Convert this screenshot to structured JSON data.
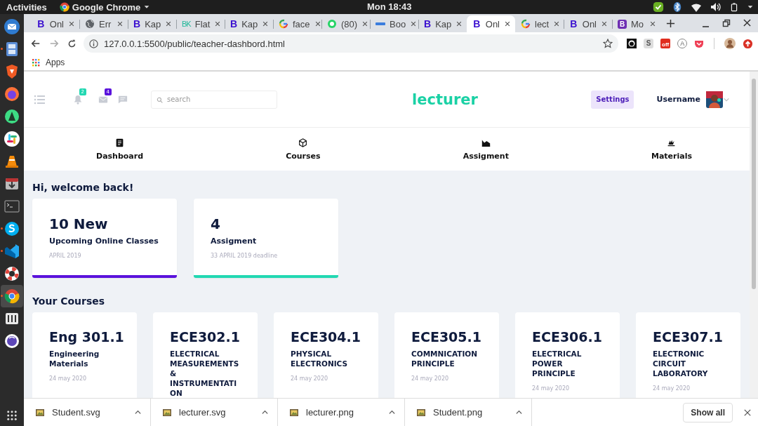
{
  "top_bar": {
    "activities": "Activities",
    "app_name": "Google Chrome",
    "clock": "Mon 18:43"
  },
  "dock": [
    {
      "kind": "mail",
      "running": false,
      "selected": false
    },
    {
      "kind": "files",
      "running": true,
      "selected": false
    },
    {
      "kind": "brave",
      "running": false,
      "selected": false
    },
    {
      "kind": "firefox",
      "running": false,
      "selected": false
    },
    {
      "kind": "android",
      "running": false,
      "selected": false
    },
    {
      "kind": "slack",
      "running": false,
      "selected": false
    },
    {
      "kind": "vlc",
      "running": false,
      "selected": false
    },
    {
      "kind": "transmission",
      "running": false,
      "selected": false
    },
    {
      "kind": "terminal",
      "running": false,
      "selected": false
    },
    {
      "kind": "skype",
      "running": true,
      "selected": false
    },
    {
      "kind": "vscode",
      "running": true,
      "selected": false
    },
    {
      "kind": "help",
      "running": false,
      "selected": false
    },
    {
      "kind": "chrome",
      "running": true,
      "selected": true
    },
    {
      "kind": "mixer",
      "running": false,
      "selected": false
    },
    {
      "kind": "eclipse",
      "running": false,
      "selected": false
    }
  ],
  "browser": {
    "tabs": [
      {
        "kind": "letter",
        "glyph": "B",
        "title": "Onl",
        "selected": false
      },
      {
        "kind": "globe",
        "title": "Err",
        "selected": false
      },
      {
        "kind": "letter",
        "glyph": "B",
        "title": "Kap",
        "selected": false
      },
      {
        "kind": "outline",
        "glyph": "BK",
        "title": "Flat",
        "selected": false
      },
      {
        "kind": "letter",
        "glyph": "B",
        "title": "Kap",
        "selected": false
      },
      {
        "kind": "google",
        "title": "face",
        "selected": false
      },
      {
        "kind": "chat",
        "title": "(80)",
        "selected": false
      },
      {
        "kind": "bar",
        "title": "Boo",
        "selected": false
      },
      {
        "kind": "letter",
        "glyph": "B",
        "title": "Kap",
        "selected": false
      },
      {
        "kind": "letter",
        "glyph": "B",
        "title": "Onl",
        "selected": true
      },
      {
        "kind": "google",
        "title": "lect",
        "selected": false
      },
      {
        "kind": "letter",
        "glyph": "B",
        "title": "Onl",
        "selected": false
      },
      {
        "kind": "square",
        "glyph": "B",
        "title": "Mo",
        "selected": false
      }
    ],
    "url": "127.0.0.1:5500/public/teacher-dashbord.html",
    "extensions": [
      {
        "kind": "github"
      },
      {
        "kind": "letter",
        "glyph": "S"
      },
      {
        "kind": "badge",
        "glyph": "off"
      },
      {
        "kind": "circle-letter",
        "glyph": "A"
      },
      {
        "kind": "pocket"
      }
    ],
    "bookmarks": [
      {
        "label": "Apps"
      }
    ]
  },
  "page": {
    "header": {
      "notifications": "2",
      "messages": "4",
      "search_placeholder": "search",
      "logo": "lecturer",
      "settings": "Settings",
      "username": "Username",
      "online": true
    },
    "nav": [
      {
        "kind": "dashboard",
        "label": "Dashboard"
      },
      {
        "kind": "courses",
        "label": "Courses"
      },
      {
        "kind": "assignment",
        "label": "Assigment"
      },
      {
        "kind": "materials",
        "label": "Materials"
      }
    ],
    "greeting": "Hi, welcome back!",
    "summary_cards": [
      {
        "value": "10 New",
        "label": "Upcoming Online Classes",
        "note": "APRIL 2019",
        "color": "#5a12dc"
      },
      {
        "value": "4",
        "label": "Assigment",
        "note": "33 APRIL 2019 deadline",
        "color": "#22d8b2"
      }
    ],
    "courses_title": "Your Courses",
    "courses": [
      {
        "code": "Eng 301.1",
        "title": "Engineering Materials",
        "date": "24 may 2020"
      },
      {
        "code": "ECE302.1",
        "title": "ELECTRICAL MEASUREMENTS & INSTRUMENTATION"
      },
      {
        "code": "ECE304.1",
        "title": "PHYSICAL ELECTRONICS",
        "date": "24 may 2020"
      },
      {
        "code": "ECE305.1",
        "title": "COMMNICATION PRINCIPLE",
        "date": "24 may 2020"
      },
      {
        "code": "ECE306.1",
        "title": "ELECTRICAL POWER PRINCIPLE",
        "date": "24 may 2020"
      },
      {
        "code": "ECE307.1",
        "title": "ELECTRONIC CIRCUIT LABORATORY",
        "date": "24 may 2020"
      }
    ]
  },
  "downloads": {
    "items": [
      {
        "name": "Student.svg"
      },
      {
        "name": "lecturer.svg"
      },
      {
        "name": "lecturer.png"
      },
      {
        "name": "Student.png"
      }
    ],
    "show_all": "Show all"
  }
}
